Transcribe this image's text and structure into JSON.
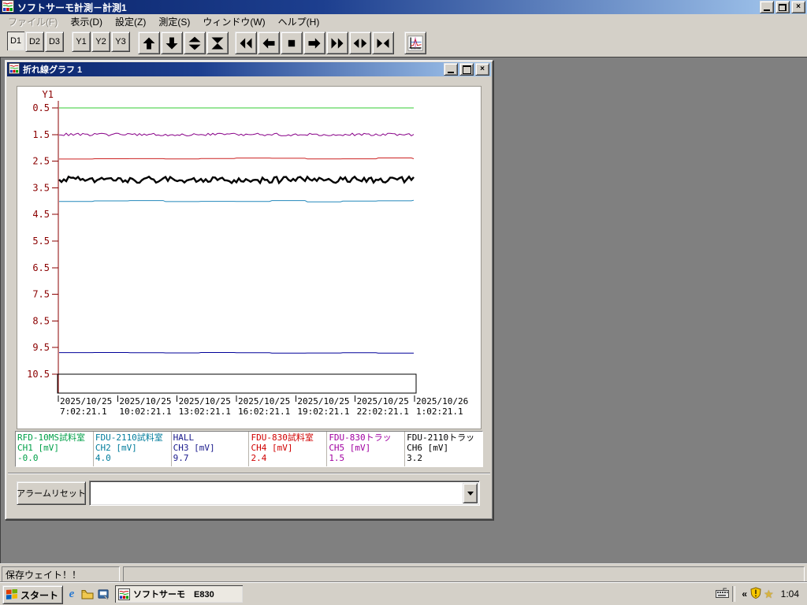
{
  "window": {
    "title": "ソフトサーモ計測－計測1"
  },
  "menu": {
    "items": [
      {
        "label": "ファイル(F)",
        "enabled": false
      },
      {
        "label": "表示(D)",
        "enabled": true
      },
      {
        "label": "設定(Z)",
        "enabled": true
      },
      {
        "label": "測定(S)",
        "enabled": true
      },
      {
        "label": "ウィンドウ(W)",
        "enabled": true
      },
      {
        "label": "ヘルプ(H)",
        "enabled": true
      }
    ]
  },
  "toolbar": {
    "d": [
      "D1",
      "D2",
      "D3"
    ],
    "pressed": "D1",
    "y": [
      "Y1",
      "Y2",
      "Y3"
    ]
  },
  "graph_window": {
    "title": "折れ線グラフ 1"
  },
  "chart_data": {
    "type": "line",
    "title": "折れ線グラフ 1",
    "y_axis": {
      "label": "Y1",
      "min": 0.5,
      "max": 10.5,
      "inverted": true,
      "ticks": [
        "0.5",
        "1.5",
        "2.5",
        "3.5",
        "4.5",
        "5.5",
        "6.5",
        "7.5",
        "8.5",
        "9.5",
        "10.5"
      ],
      "color": "#8b0000"
    },
    "x_axis": {
      "labels": [
        [
          "2025/10/25",
          "7:02:21.1"
        ],
        [
          "2025/10/25",
          "10:02:21.1"
        ],
        [
          "2025/10/25",
          "13:02:21.1"
        ],
        [
          "2025/10/25",
          "16:02:21.1"
        ],
        [
          "2025/10/25",
          "19:02:21.1"
        ],
        [
          "2025/10/25",
          "22:02:21.1"
        ],
        [
          "2025/10/26",
          "1:02:21.1"
        ]
      ]
    },
    "series": [
      {
        "name": "RFD-10MS試料室",
        "channel": "CH1 [mV]",
        "value": -0.0,
        "display_value": "-0.0",
        "color": "#00a048",
        "line_color": "#33cc33",
        "noise": 0.0
      },
      {
        "name": "FDU-2110試料室",
        "channel": "CH2 [mV]",
        "value": 4.0,
        "display_value": "4.0",
        "color": "#007c9c",
        "line_color": "#2288bb",
        "noise": 0.035,
        "stepped": true
      },
      {
        "name": "HALL",
        "channel": "CH3 [mV]",
        "value": 9.7,
        "display_value": "9.7",
        "color": "#1a1a8c",
        "line_color": "#000099",
        "noise": 0.015,
        "stepped": true
      },
      {
        "name": "FDU-830試料室",
        "channel": "CH4 [mV]",
        "value": 2.4,
        "display_value": "2.4",
        "color": "#d00000",
        "line_color": "#cc2222",
        "noise": 0.025,
        "stepped": true
      },
      {
        "name": "FDU-830トラッ",
        "channel": "CH5 [mV]",
        "value": 1.5,
        "display_value": "1.5",
        "color": "#a000a0",
        "line_color": "#880088",
        "noise": 0.05
      },
      {
        "name": "FDU-2110トラッ",
        "channel": "CH6 [mV]",
        "value": 3.2,
        "display_value": "3.2",
        "color": "#000000",
        "line_color": "#000000",
        "noise": 0.12,
        "thick": true
      }
    ]
  },
  "controls": {
    "alarm_reset_label": "アラームリセット",
    "combo_value": ""
  },
  "status_bar": {
    "message": "保存ウェイト！！",
    "right": ""
  },
  "taskbar": {
    "start_label": "スタート",
    "task_label": "ソフトサーモ　E830",
    "clock": "1:04"
  },
  "icons": {
    "close": "×",
    "expand_left": "«",
    "star": "★",
    "ie": "e"
  }
}
